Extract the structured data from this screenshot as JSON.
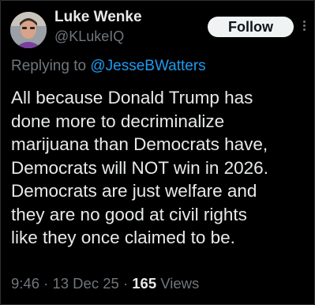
{
  "author": {
    "name": "Luke Wenke",
    "handle": "@KLukeIQ"
  },
  "actions": {
    "follow_label": "Follow",
    "more_icon": "more-vertical-icon"
  },
  "reply": {
    "prefix": "Replying to",
    "mention": "@JesseBWatters"
  },
  "tweet": {
    "lines": [
      "All because Donald Trump has",
      "done more to decriminalize",
      "marijuana than Democrats have,",
      "Democrats will NOT win in 2026.",
      "Democrats are just welfare and",
      "they are no good at civil rights",
      "like they once claimed to be."
    ]
  },
  "meta": {
    "time": "9:46",
    "date": "13 Dec 25",
    "views_count": "165",
    "views_label": "Views",
    "separator": "·"
  },
  "colors": {
    "background": "#000000",
    "text": "#e7e9ea",
    "secondary": "#71767b",
    "link": "#1d9bf0",
    "button_bg": "#eff3f4"
  }
}
